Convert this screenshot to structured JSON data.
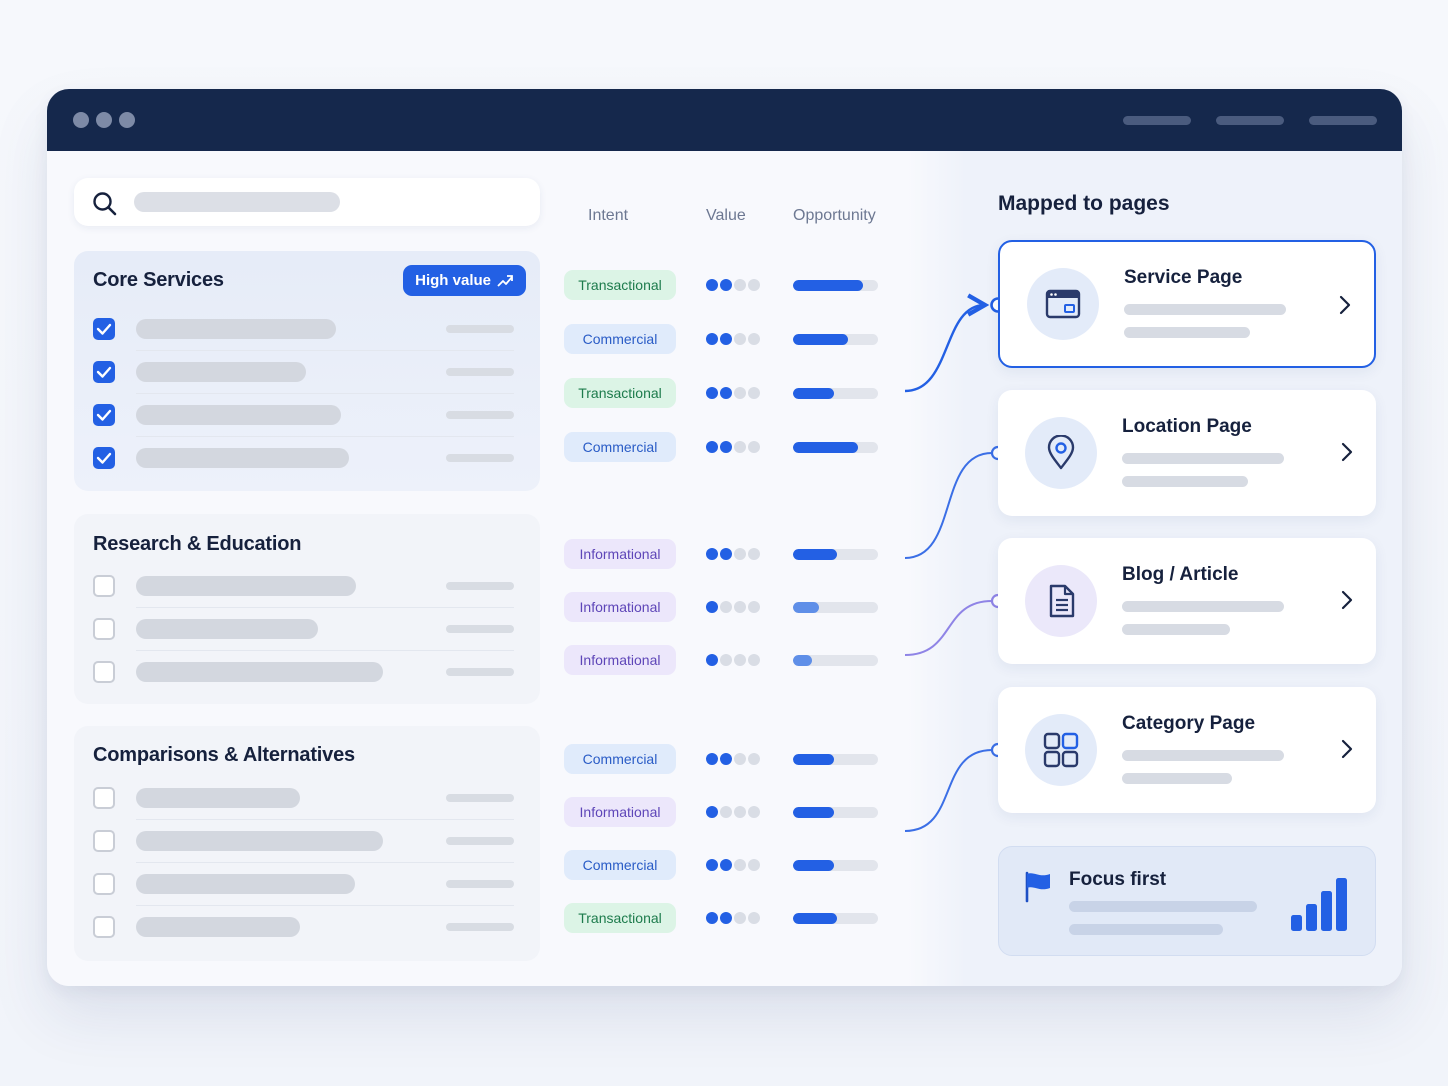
{
  "left_panel": {
    "groups": [
      {
        "title": "Core Services",
        "badge": "High value"
      },
      {
        "title": "Research & Education"
      },
      {
        "title": "Comparisons & Alternatives"
      }
    ]
  },
  "columns": {
    "intent": "Intent",
    "value": "Value",
    "opportunity": "Opportunity"
  },
  "keywords": [
    {
      "intent": "Transactional",
      "value": 2,
      "opportunity": 0.82
    },
    {
      "intent": "Commercial",
      "value": 2,
      "opportunity": 0.65
    },
    {
      "intent": "Transactional",
      "value": 2,
      "opportunity": 0.48
    },
    {
      "intent": "Commercial",
      "value": 2,
      "opportunity": 0.77
    },
    {
      "intent": "Informational",
      "value": 2,
      "opportunity": 0.52
    },
    {
      "intent": "Informational",
      "value": 1,
      "opportunity": 0.31
    },
    {
      "intent": "Informational",
      "value": 1,
      "opportunity": 0.22
    },
    {
      "intent": "Commercial",
      "value": 2,
      "opportunity": 0.48
    },
    {
      "intent": "Informational",
      "value": 1,
      "opportunity": 0.48
    },
    {
      "intent": "Commercial",
      "value": 2,
      "opportunity": 0.48
    },
    {
      "intent": "Transactional",
      "value": 2,
      "opportunity": 0.52
    }
  ],
  "checklist": {
    "core_services": [
      true,
      true,
      true,
      true
    ],
    "research_education": [
      false,
      false,
      false
    ],
    "comparisons_alternatives": [
      false,
      false,
      false,
      false
    ]
  },
  "mapped": {
    "title": "Mapped to pages",
    "pages": [
      {
        "title": "Service Page",
        "icon": "browser-window-icon",
        "selected": true
      },
      {
        "title": "Location Page",
        "icon": "map-pin-icon",
        "selected": false
      },
      {
        "title": "Blog / Article",
        "icon": "document-icon",
        "selected": false
      },
      {
        "title": "Category Page",
        "icon": "grid-icon",
        "selected": false
      }
    ]
  },
  "focus": {
    "title": "Focus first",
    "icon": "flag-icon",
    "chart_icon": "bar-chart-icon"
  },
  "colors": {
    "accent": "#2360e4",
    "titlebar": "#15284c",
    "transactional_bg": "#dcf4e6",
    "commercial_bg": "#e0ebfb",
    "informational_bg": "#ece7fb"
  }
}
